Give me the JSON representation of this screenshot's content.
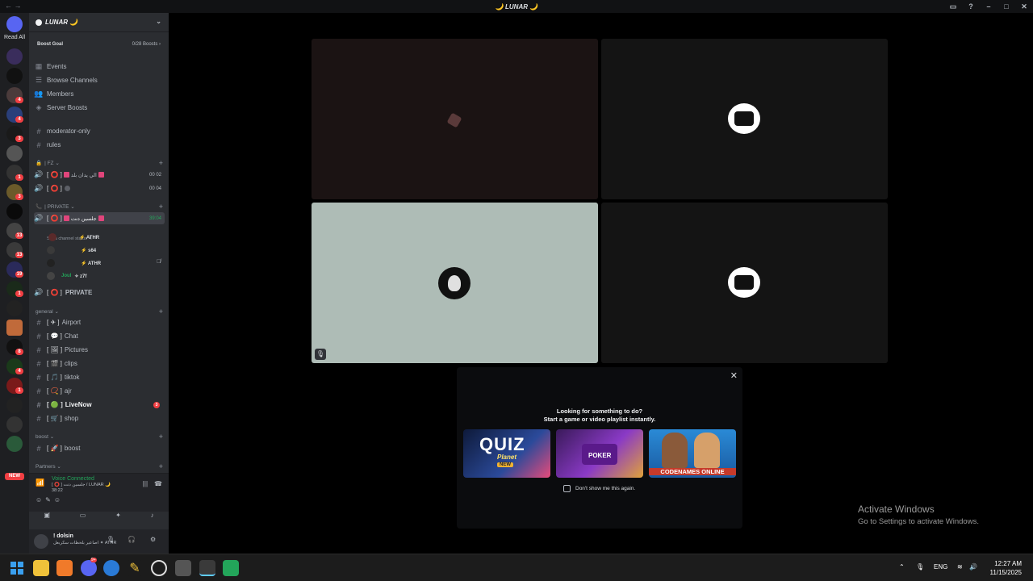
{
  "window": {
    "title": "🌙 LUNAR 🌙",
    "back": "← →"
  },
  "rail": {
    "read_all": "Read All",
    "new_label": "NEW"
  },
  "server": {
    "name": "LUNAR 🌙",
    "boost_goal": "Boost Goal",
    "boost_count": "0/28 Boosts ›"
  },
  "nav": {
    "events": "Events",
    "browse": "Browse Channels",
    "members": "Members",
    "boosts": "Server Boosts"
  },
  "channels": {
    "moderator": "moderator-only",
    "rules": "rules",
    "cat_fz": "| FZ ⌄",
    "v1_tag": "[ ⭕ ]",
    "v1_name": "الي يدان بلد",
    "v1_count": "00 02",
    "v2_tag": "[ ⭕ ]",
    "v2_count": "00 04",
    "cat_private": "| PRIVATE ⌄",
    "v3_tag": "[ ⭕ ]",
    "v3_name": "جلسين دنت",
    "v3_time": "39:04",
    "set_status": "Set a channel status ✎",
    "u1": "⚡ ATHR",
    "u2": "⚡ s64",
    "u3": "⚡ ATHR",
    "u4_name": "Joul",
    "u4_tag": "✧ z7f",
    "private": "PRIVATE",
    "private_tag": "[ ⭕ ]",
    "cat_general": "general ⌄",
    "airport": "Airport",
    "airport_tag": "[ ✈ ]",
    "chat": "Chat",
    "chat_tag": "[ 💬 ]",
    "pictures": "Pictures",
    "pictures_tag": "[ 🖼 ]",
    "clips": "clips",
    "clips_tag": "[ 🎬 ]",
    "tiktok": "tiktok",
    "tiktok_tag": "[ 🎵 ]",
    "ajr": "ajr",
    "ajr_tag": "[ 📿 ]",
    "livenow": "LiveNow",
    "livenow_tag": "[ 🟢 ]",
    "livenow_badge": "3",
    "shop": "shop",
    "shop_tag": "[ 🛒 ]",
    "cat_boost": "boost ⌄",
    "boost": "boost",
    "boost_tag": "[ 🚀 ]",
    "cat_partners": "Partners ⌄"
  },
  "voice": {
    "connected": "Voice Connected",
    "channel": "[ ⭕ ] جلسين دنت / LUNAR 🌙",
    "time": "38:22"
  },
  "user": {
    "name": "! dolsin",
    "status": "اصاعير بلحظات سكربعل ✦ ATHR"
  },
  "popup": {
    "title1": "Looking for something to do?",
    "title2": "Start a game or video playlist instantly.",
    "quiz_title": "QUIZ",
    "quiz_sub": "Planet",
    "quiz_new": "NEW",
    "poker": "POKER",
    "codenames": "CODENAMES ONLINE",
    "checkbox_label": "Don't show me this again."
  },
  "watermark": {
    "line1": "Activate Windows",
    "line2": "Go to Settings to activate Windows."
  },
  "taskbar": {
    "lang": "ENG",
    "time": "12:27 AM",
    "date": "11/15/2025",
    "discord_badge": "9+"
  },
  "colors": {
    "accent": "#5865f2",
    "online": "#23a55a",
    "alert": "#f23f43",
    "tile_light": "#aebcb6"
  }
}
